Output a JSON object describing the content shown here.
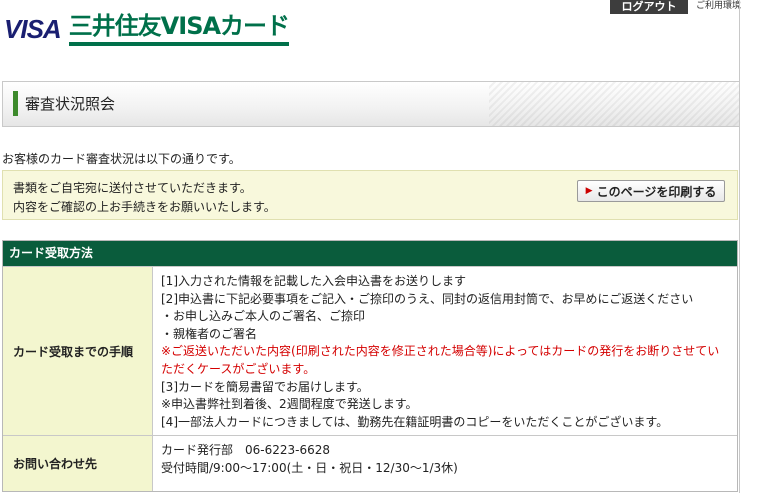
{
  "header": {
    "visa_mark": "VISA",
    "brand": "三井住友VISAカード",
    "logout_label": "ログアウト",
    "env_link": "ご利用環境"
  },
  "page": {
    "title": "審査状況照会",
    "intro": "お客様のカード審査状況は以下の通りです。"
  },
  "notice": {
    "line1": "書類をご自宅宛に送付させていただきます。",
    "line2": "内容をご確認の上お手続きをお願いいたします。",
    "print_label": "このページを印刷する"
  },
  "table": {
    "heading": "カード受取方法",
    "rows": [
      {
        "label": "カード受取までの手順",
        "lines": [
          "[1]入力された情報を記載した入会申込書をお送りします",
          "[2]申込書に下記必要事項をご記入・ご捺印のうえ、同封の返信用封筒で、お早めにご返送ください",
          "・お申し込みご本人のご署名、ご捺印",
          "・親権者のご署名",
          "※ご返送いただいた内容(印刷された内容を修正された場合等)によってはカードの発行をお断りさせていただくケースがございます。",
          "[3]カードを簡易書留でお届けします。",
          "※申込書弊社到着後、2週間程度で発送します。",
          "[4]一部法人カードにつきましては、勤務先在籍証明書のコピーをいただくことがございます。"
        ]
      },
      {
        "label": "お問い合わせ先",
        "lines": [
          "カード発行部　06-6223-6628",
          "受付時間/9:00〜17:00(土・日・祝日・12/30〜1/3休)"
        ]
      }
    ]
  },
  "colors": {
    "brand_green": "#00704a",
    "table_header": "#0a5c3c",
    "label_bg": "#f3f6cf",
    "warning_red": "#d40000"
  }
}
